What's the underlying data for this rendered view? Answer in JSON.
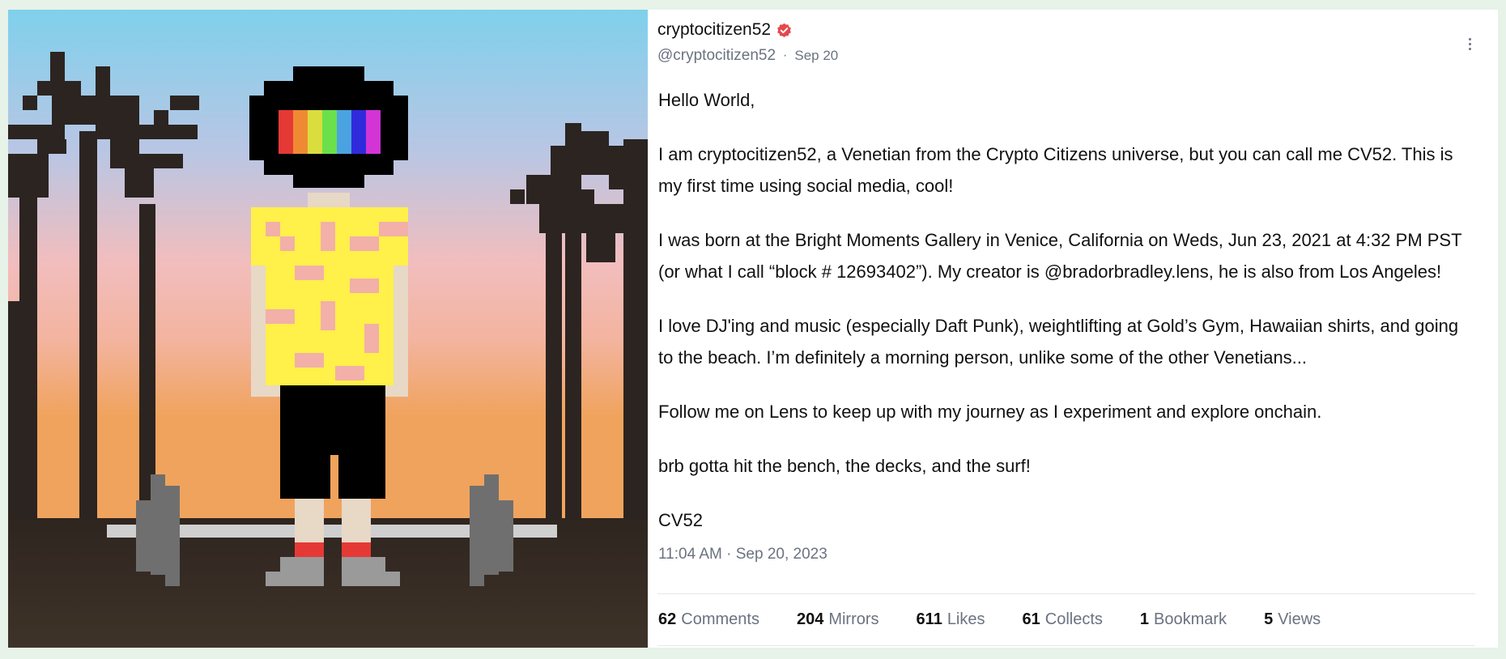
{
  "author": {
    "display_name": "cryptocitizen52",
    "handle": "@cryptocitizen52",
    "date": "Sep 20",
    "verified_icon": "verified-badge-icon",
    "verified_color": "#e5484d"
  },
  "post": {
    "paragraphs": [
      "Hello World,",
      "I am cryptocitizen52, a Venetian from the Crypto Citizens universe, but you can call me CV52. This is my first time using social media, cool!",
      "I was born at the Bright Moments Gallery in Venice, California on Weds, Jun 23, 2021 at 4:32 PM PST (or what I call “block # 12693402”). My creator is @bradorbradley.lens, he is also from Los Angeles!",
      "I love DJ'ing and music (especially Daft Punk), weightlifting at Gold’s Gym, Hawaiian shirts, and going to the beach. I’m definitely a morning person, unlike some of the other Venetians...",
      "Follow me on Lens to keep up with my journey as I experiment and explore onchain.",
      "brb gotta hit the bench, the decks, and the surf!",
      "CV52"
    ],
    "timestamp": "11:04 AM · Sep 20, 2023"
  },
  "stats": [
    {
      "count": "62",
      "label": "Comments"
    },
    {
      "count": "204",
      "label": "Mirrors"
    },
    {
      "count": "611",
      "label": "Likes"
    },
    {
      "count": "61",
      "label": "Collects"
    },
    {
      "count": "1",
      "label": "Bookmark"
    },
    {
      "count": "5",
      "label": "Views"
    }
  ],
  "icons": {
    "more": "more-options-icon"
  },
  "colors": {
    "page_background": "#e7f2e8",
    "muted_text": "#6b7280"
  }
}
